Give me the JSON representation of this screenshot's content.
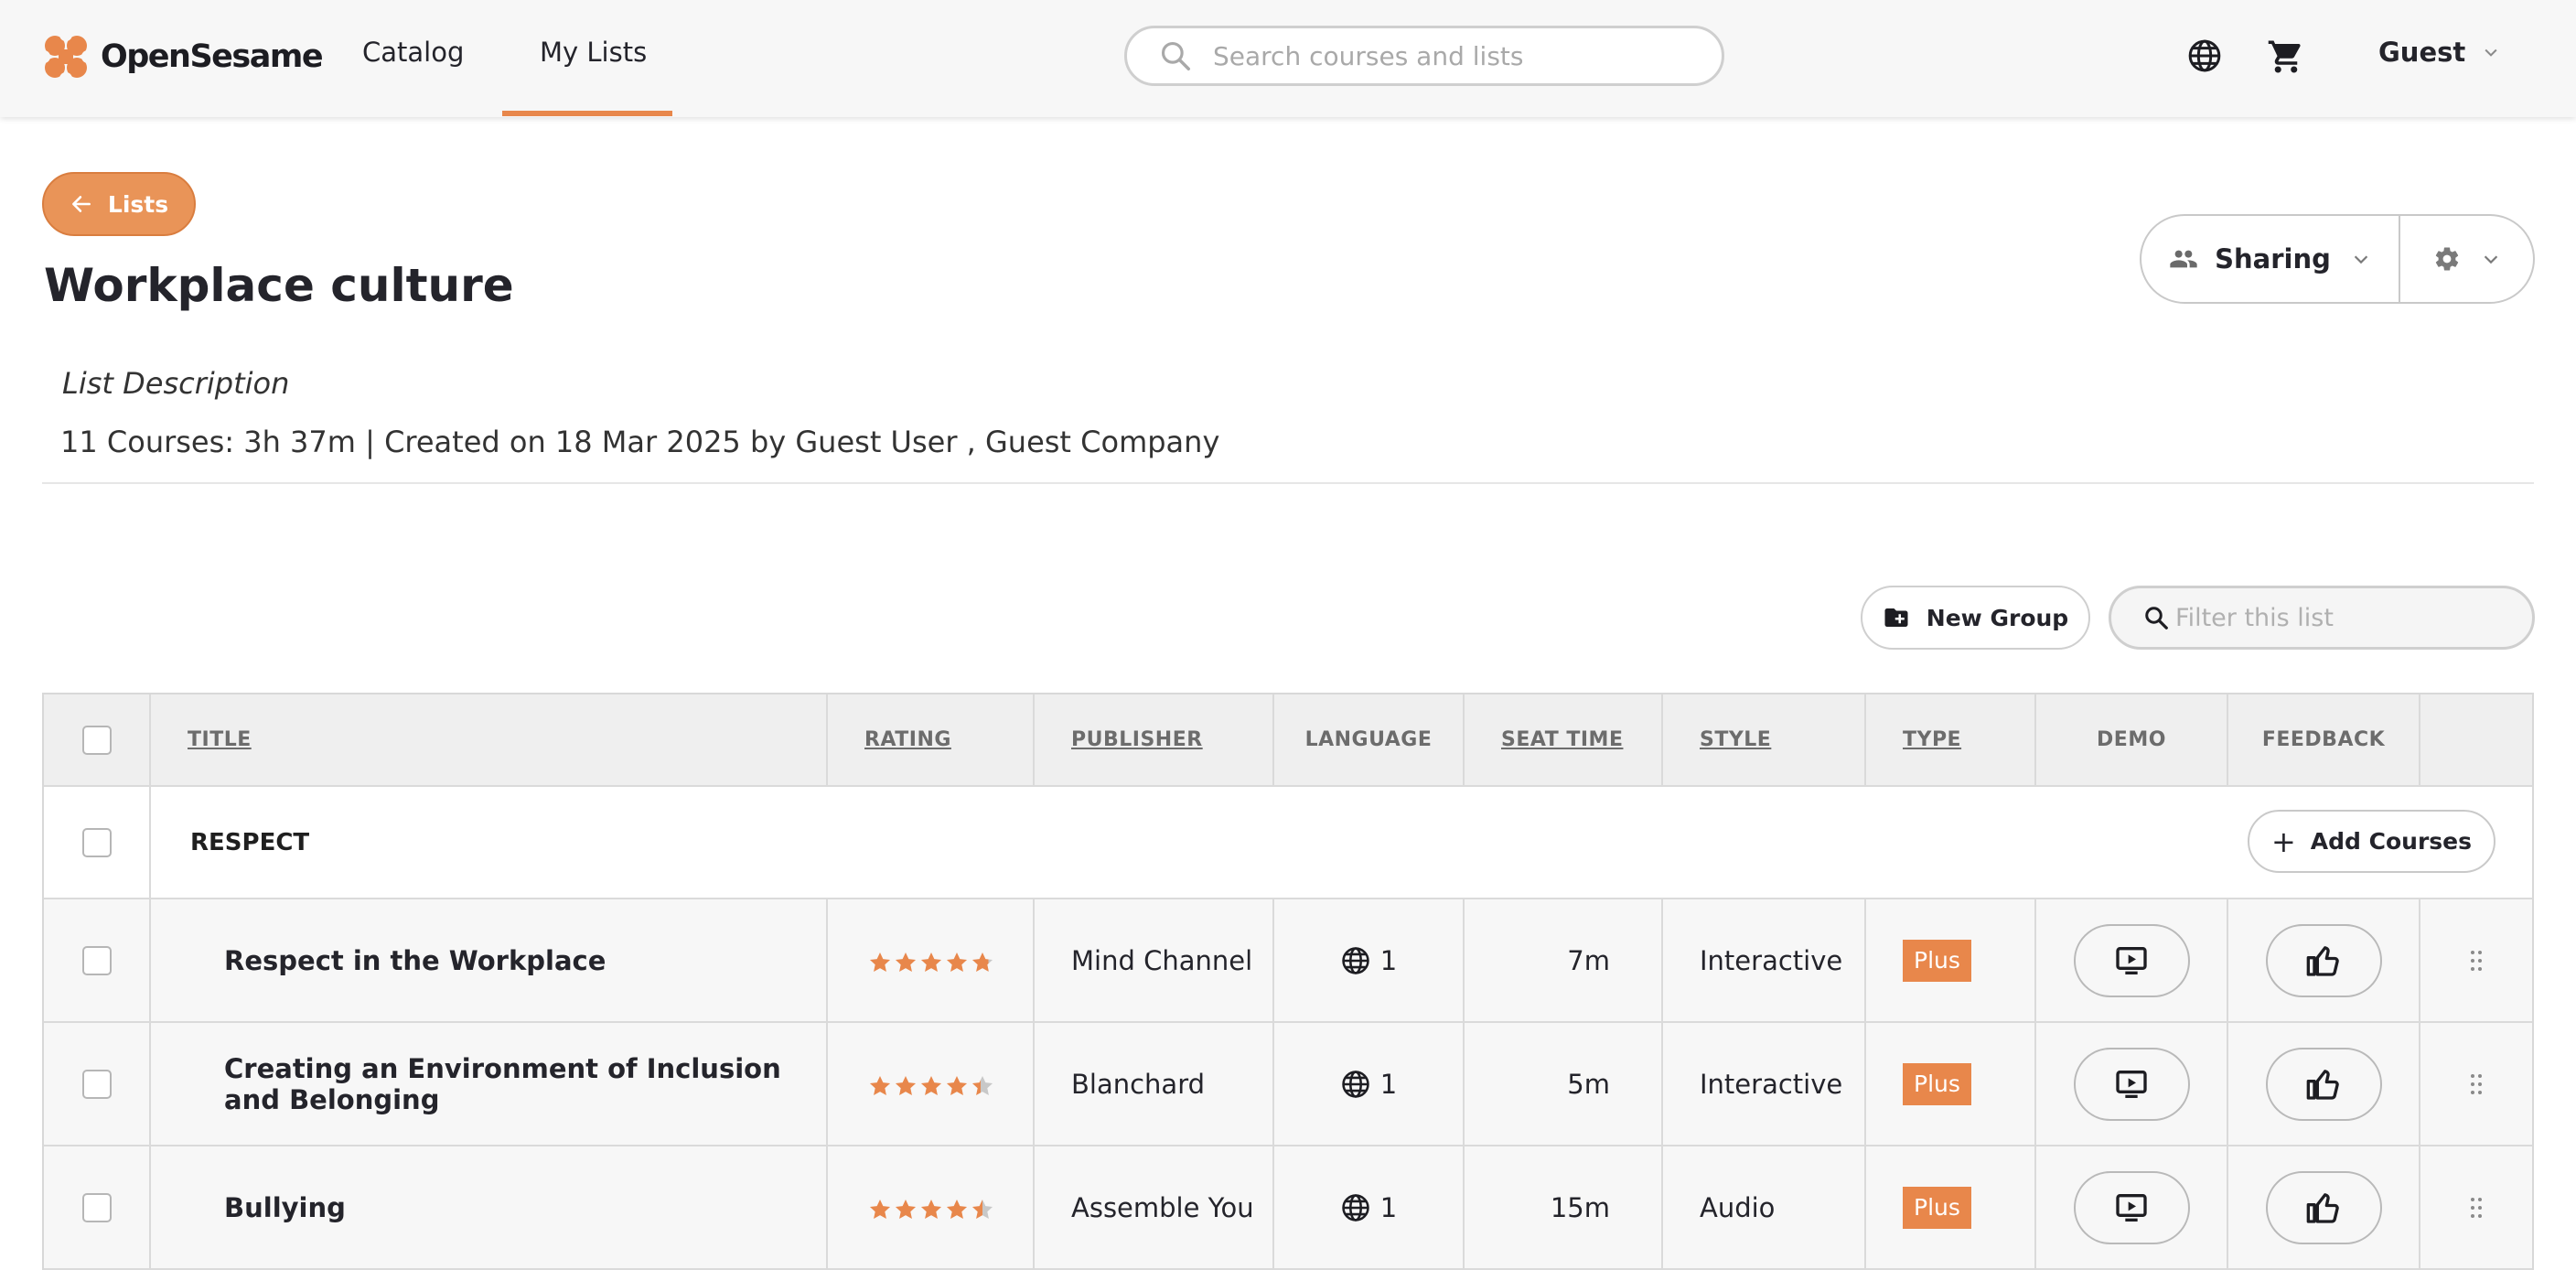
{
  "brand": {
    "name": "OpenSesame",
    "accent": "#e8874b"
  },
  "nav": {
    "catalog": "Catalog",
    "my_lists": "My Lists",
    "search_placeholder": "Search courses and lists",
    "user": "Guest"
  },
  "header": {
    "back_label": "Lists",
    "title": "Workplace culture",
    "sharing_label": "Sharing",
    "description_label": "List Description",
    "meta": "11 Courses: 3h 37m | Created on 18 Mar 2025 by Guest User , Guest Company"
  },
  "toolbar": {
    "new_group": "New Group",
    "filter_placeholder": "Filter this list"
  },
  "table": {
    "columns": {
      "title": "TITLE",
      "rating": "RATING",
      "publisher": "PUBLISHER",
      "language": "LANGUAGE",
      "seat_time": "SEAT TIME",
      "style": "STYLE",
      "type": "TYPE",
      "demo": "DEMO",
      "feedback": "FEEDBACK"
    },
    "group": {
      "name": "RESPECT",
      "add_courses": "Add Courses"
    },
    "rows": [
      {
        "title": "Respect in the Workplace",
        "rating": 4.8,
        "publisher": "Mind Channel",
        "languages": "1",
        "seat_time": "7m",
        "style": "Interactive",
        "type": "Plus"
      },
      {
        "title": "Creating an Environment of Inclusion and Belonging",
        "rating": 4.4,
        "publisher": "Blanchard",
        "languages": "1",
        "seat_time": "5m",
        "style": "Interactive",
        "type": "Plus"
      },
      {
        "title": "Bullying",
        "rating": 4.5,
        "publisher": "Assemble You",
        "languages": "1",
        "seat_time": "15m",
        "style": "Audio",
        "type": "Plus"
      }
    ]
  }
}
